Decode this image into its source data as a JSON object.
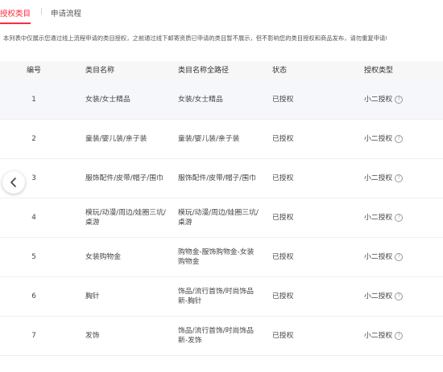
{
  "tabs": {
    "active": "授权类目",
    "separator": "|",
    "second": "申请流程"
  },
  "notice": "本列表中仅展示您通过线上流程申请的类目授权，之前通过线下邮寄资质已申请的类目暂不展示，但不影响您的类目授权和商品发布，请勿重复申请!",
  "table": {
    "headers": {
      "num": "编号",
      "name": "类目名称",
      "path": "类目名称全路径",
      "status": "状态",
      "type": "授权类型"
    },
    "rows": [
      {
        "num": "1",
        "name": "女装/女士精品",
        "path": "女装/女士精品",
        "status": "已授权",
        "type": "小二授权"
      },
      {
        "num": "2",
        "name": "童装/婴儿装/亲子装",
        "path": "童装/婴儿装/亲子装",
        "status": "已授权",
        "type": "小二授权"
      },
      {
        "num": "3",
        "name": "服饰配件/皮带/帽子/围巾",
        "path": "服饰配件/皮带/帽子/围巾",
        "status": "已授权",
        "type": "小二授权"
      },
      {
        "num": "4",
        "name": "模玩/动漫/周边/娃圈三坑/桌游",
        "path": "模玩/动漫/周边/娃圈三坑/桌游",
        "status": "已授权",
        "type": "小二授权"
      },
      {
        "num": "5",
        "name": "女装购物金",
        "path": "购物金-服饰购物金-女装购物金",
        "status": "已授权",
        "type": "小二授权"
      },
      {
        "num": "6",
        "name": "胸针",
        "path": "饰品/流行首饰/时尚饰品新-胸针",
        "status": "已授权",
        "type": "小二授权"
      },
      {
        "num": "7",
        "name": "发饰",
        "path": "饰品/流行首饰/时尚饰品新-发饰",
        "status": "已授权",
        "type": "小二授权"
      }
    ],
    "help_glyph": "?"
  },
  "nav": {
    "prev_icon": "chevron-left-icon"
  },
  "colors": {
    "accent": "#ff2a3f"
  }
}
